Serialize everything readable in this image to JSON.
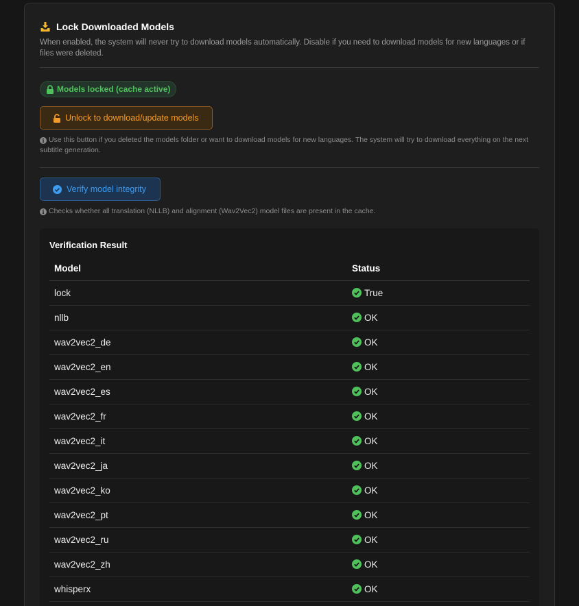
{
  "section": {
    "title": "Lock Downloaded Models",
    "description": "When enabled, the system will never try to download models automatically. Disable if you need to download models for new languages or if files were deleted.",
    "icon": "download-icon"
  },
  "lock_status": {
    "badge_label": "Models locked (cache active)",
    "icon": "lock-icon",
    "color": "#4fc15b"
  },
  "unlock": {
    "button_label": "Unlock to download/update models",
    "icon": "unlock-icon",
    "color": "#f39b2a",
    "hint": "Use this button if you deleted the models folder or want to download models for new languages. The system will try to download everything on the next subtitle generation."
  },
  "verify": {
    "button_label": "Verify model integrity",
    "icon": "check-circle-icon",
    "color": "#3d9bf0",
    "hint": "Checks whether all translation (NLLB) and alignment (Wav2Vec2) model files are present in the cache."
  },
  "verification": {
    "title": "Verification Result",
    "columns": {
      "model": "Model",
      "status": "Status"
    },
    "rows": [
      {
        "model": "lock",
        "status": "True"
      },
      {
        "model": "nllb",
        "status": "OK"
      },
      {
        "model": "wav2vec2_de",
        "status": "OK"
      },
      {
        "model": "wav2vec2_en",
        "status": "OK"
      },
      {
        "model": "wav2vec2_es",
        "status": "OK"
      },
      {
        "model": "wav2vec2_fr",
        "status": "OK"
      },
      {
        "model": "wav2vec2_it",
        "status": "OK"
      },
      {
        "model": "wav2vec2_ja",
        "status": "OK"
      },
      {
        "model": "wav2vec2_ko",
        "status": "OK"
      },
      {
        "model": "wav2vec2_pt",
        "status": "OK"
      },
      {
        "model": "wav2vec2_ru",
        "status": "OK"
      },
      {
        "model": "wav2vec2_zh",
        "status": "OK"
      },
      {
        "model": "whisperx",
        "status": "OK"
      }
    ],
    "status_color": "#4fc15b"
  }
}
